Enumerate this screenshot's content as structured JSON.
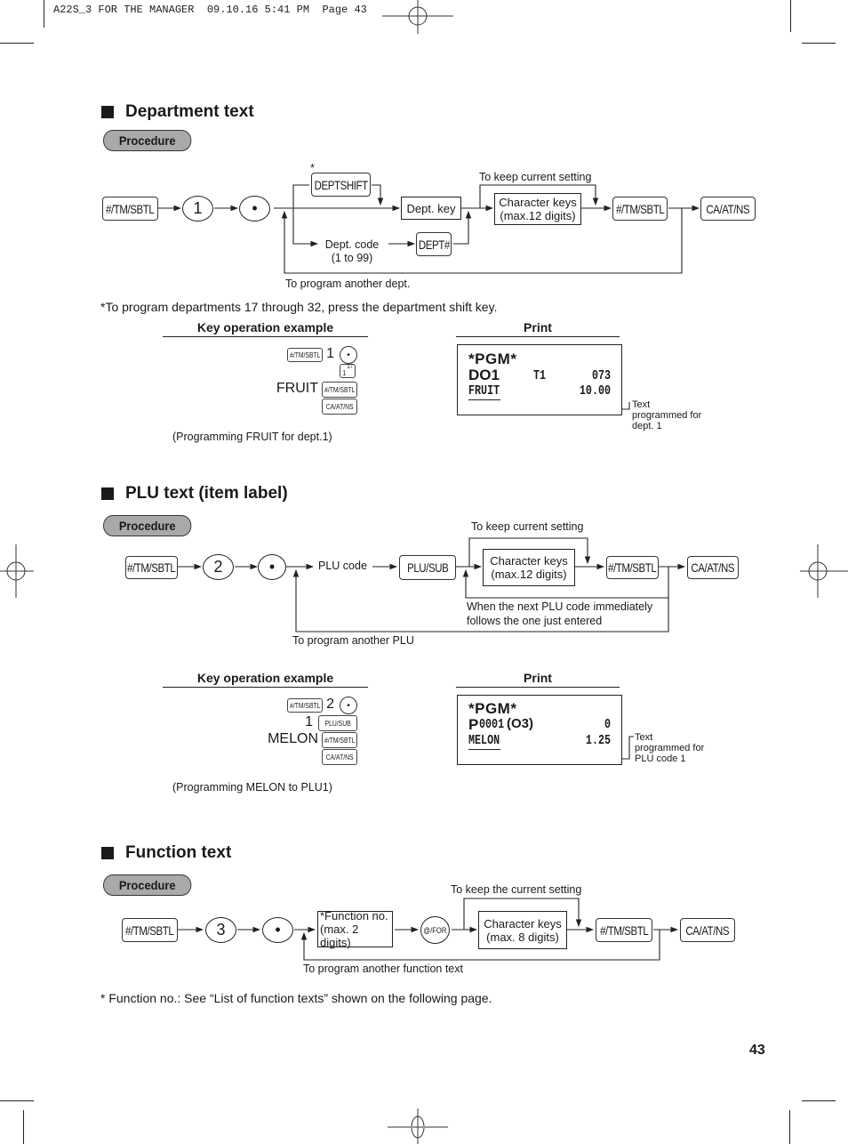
{
  "header": {
    "print_line": "A22S_3 FOR THE MANAGER  09.10.16 5:41 PM  Page 43"
  },
  "sections": {
    "department": {
      "title": "Department text",
      "procedure_label": "Procedure",
      "keys": {
        "tm_sbtl": "#/TM/SBTL",
        "digit": "1",
        "dot": "•",
        "deptshift": "DEPTSHIFT",
        "deptshift_asterisk": "*",
        "dept_hash": "DEPT#",
        "tm_sbtl_2": "#/TM/SBTL",
        "ca_at_ns": "CA/AT/NS"
      },
      "boxes": {
        "dept_key": "Dept. key",
        "char_keys_line1": "Character keys",
        "char_keys_line2": "(max.12 digits)"
      },
      "labels": {
        "dept_code_line1": "Dept. code",
        "dept_code_line2": "(1 to 99)",
        "keep_setting": "To keep current setting",
        "another": "To program another dept."
      },
      "footnote": "*To program departments 17 through 32, press the department shift key.",
      "example": {
        "heading": "Key operation example",
        "key_tm_sbtl": "#/TM/SBTL",
        "digit": "1",
        "dot": "•",
        "dept_key_main": "1",
        "dept_key_sup": "17",
        "word": "FRUIT",
        "key_tm_sbtl_2": "#/TM/SBTL",
        "key_ca": "CA/AT/NS",
        "caption": "(Programming FRUIT for dept.1)"
      },
      "print": {
        "heading": "Print",
        "line1": "*PGM*",
        "line2_code": "DO1",
        "line2_mid": "T1",
        "line2_right": "073",
        "line3_text": "FRUIT",
        "line3_right": "10.00",
        "callout_line1": "Text",
        "callout_line2": "programmed for",
        "callout_line3": "dept. 1"
      }
    },
    "plu": {
      "title": "PLU text (item label)",
      "procedure_label": "Procedure",
      "keys": {
        "tm_sbtl": "#/TM/SBTL",
        "digit": "2",
        "dot": "•",
        "plu_sub": "PLU/SUB",
        "tm_sbtl_2": "#/TM/SBTL",
        "ca_at_ns": "CA/AT/NS"
      },
      "boxes": {
        "char_keys_line1": "Character keys",
        "char_keys_line2": "(max.12 digits)"
      },
      "labels": {
        "plu_code": "PLU code",
        "keep_setting": "To keep current setting",
        "next_line1": "When the next PLU code immediately",
        "next_line2": "follows the one just entered",
        "another": "To program another PLU"
      },
      "example": {
        "heading": "Key operation example",
        "key_tm_sbtl": "#/TM/SBTL",
        "digit": "2",
        "dot": "•",
        "plu_num": "1",
        "key_plu_sub": "PLU/SUB",
        "word": "MELON",
        "key_tm_sbtl_2": "#/TM/SBTL",
        "key_ca": "CA/AT/NS",
        "caption": "(Programming MELON to PLU1)"
      },
      "print": {
        "heading": "Print",
        "line1": "*PGM*",
        "line2_p": "P",
        "line2_code": "0001",
        "line2_paren": "(O3)",
        "line2_right": "0",
        "line3_text": "MELON",
        "line3_right": "1.25",
        "callout_line1": "Text",
        "callout_line2": "programmed for",
        "callout_line3": "PLU code 1"
      }
    },
    "function": {
      "title": "Function text",
      "procedure_label": "Procedure",
      "keys": {
        "tm_sbtl": "#/TM/SBTL",
        "digit": "3",
        "dot": "•",
        "at_for": "@/FOR",
        "tm_sbtl_2": "#/TM/SBTL",
        "ca_at_ns": "CA/AT/NS"
      },
      "boxes": {
        "func_no_line1": "*Function no.",
        "func_no_line2": "(max. 2 digits)",
        "char_keys_line1": "Character keys",
        "char_keys_line2": "(max. 8 digits)"
      },
      "labels": {
        "keep_setting": "To keep the current setting",
        "another": "To program another function text"
      },
      "footnote": "* Function no.: See “List of function texts” shown on the following page."
    }
  },
  "page_number": "43"
}
